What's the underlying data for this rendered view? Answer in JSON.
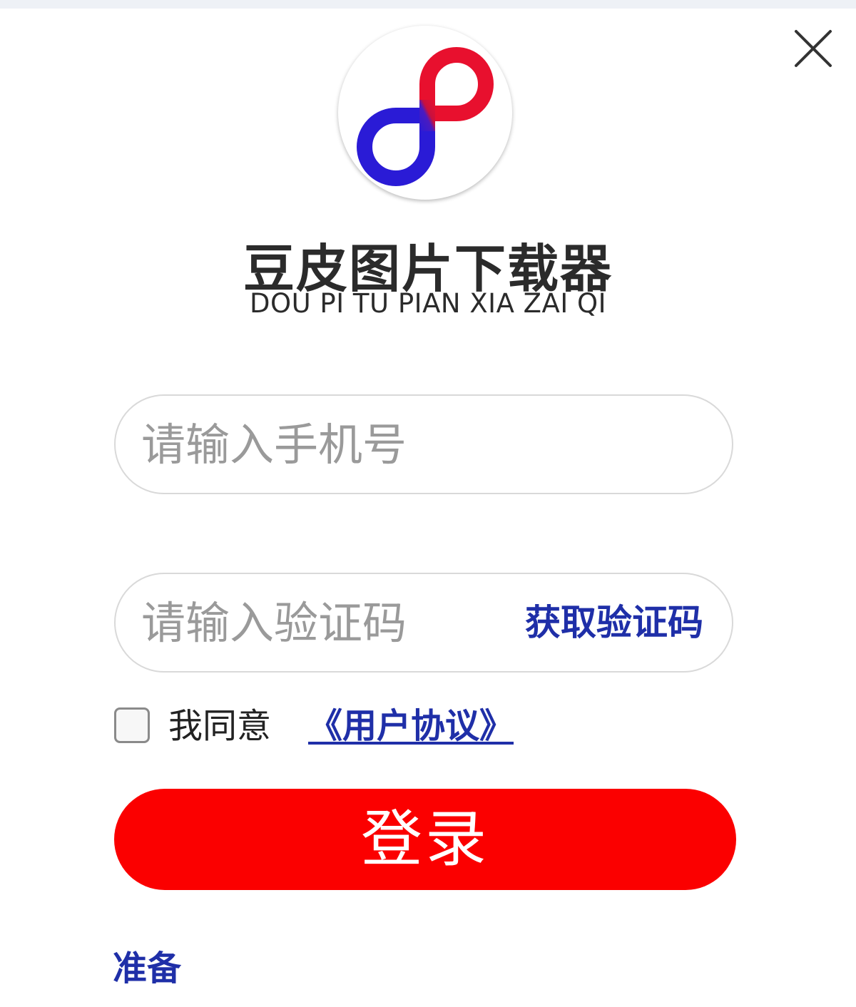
{
  "app": {
    "title": "豆皮图片下载器",
    "subtitle": "DOU PI TU PIAN XIA ZAI QI"
  },
  "phone": {
    "placeholder": "请输入手机号",
    "value": ""
  },
  "code": {
    "placeholder": "请输入验证码",
    "value": "",
    "get_code_label": "获取验证码"
  },
  "agreement": {
    "agree_label": "我同意",
    "link_label": "《用户协议》",
    "checked": false
  },
  "login": {
    "label": "登录"
  },
  "status": {
    "text": "准备"
  },
  "icons": {
    "close": "close-icon",
    "logo": "infinity-logo-icon"
  },
  "colors": {
    "accent_red": "#fb0000",
    "link_blue": "#1f2fa8",
    "logo_red": "#e8102e",
    "logo_blue": "#2a1bd6"
  }
}
